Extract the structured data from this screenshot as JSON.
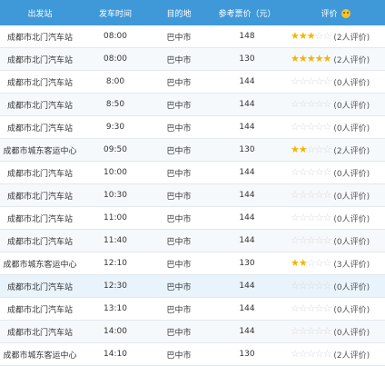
{
  "header": {
    "station": "出发站",
    "time": "发车时间",
    "destination": "目的地",
    "price": "参考票价（元）",
    "rating": "评价",
    "rating_icon": "smiley-face-icon"
  },
  "colors": {
    "header_bg": "#3f99d8",
    "star_on": "#f5b400",
    "star_off": "#d7d7d7"
  },
  "rows": [
    {
      "station": "成都市北门汽车站",
      "time": "08:00",
      "destination": "巴中市",
      "price": "148",
      "stars": 3,
      "count": "(2人评价)"
    },
    {
      "station": "成都市北门汽车站",
      "time": "08:00",
      "destination": "巴中市",
      "price": "130",
      "stars": 5,
      "count": "(2人评价)"
    },
    {
      "station": "成都市北门汽车站",
      "time": "8:00",
      "destination": "巴中市",
      "price": "144",
      "stars": 0,
      "count": "(0人评价)"
    },
    {
      "station": "成都市北门汽车站",
      "time": "8:50",
      "destination": "巴中市",
      "price": "144",
      "stars": 0,
      "count": "(0人评价)"
    },
    {
      "station": "成都市北门汽车站",
      "time": "9:30",
      "destination": "巴中市",
      "price": "144",
      "stars": 0,
      "count": "(0人评价)"
    },
    {
      "station": "成都市城东客运中心",
      "time": "09:50",
      "destination": "巴中市",
      "price": "130",
      "stars": 2,
      "count": "(2人评价)"
    },
    {
      "station": "成都市北门汽车站",
      "time": "10:00",
      "destination": "巴中市",
      "price": "144",
      "stars": 0,
      "count": "(0人评价)"
    },
    {
      "station": "成都市北门汽车站",
      "time": "10:30",
      "destination": "巴中市",
      "price": "144",
      "stars": 0,
      "count": "(0人评价)"
    },
    {
      "station": "成都市北门汽车站",
      "time": "11:00",
      "destination": "巴中市",
      "price": "144",
      "stars": 0,
      "count": "(0人评价)"
    },
    {
      "station": "成都市北门汽车站",
      "time": "11:40",
      "destination": "巴中市",
      "price": "144",
      "stars": 0,
      "count": "(0人评价)"
    },
    {
      "station": "成都市城东客运中心",
      "time": "12:10",
      "destination": "巴中市",
      "price": "130",
      "stars": 2,
      "count": "(3人评价)"
    },
    {
      "station": "成都市北门汽车站",
      "time": "12:30",
      "destination": "巴中市",
      "price": "144",
      "stars": 0,
      "count": "(0人评价)",
      "highlight": true
    },
    {
      "station": "成都市北门汽车站",
      "time": "13:10",
      "destination": "巴中市",
      "price": "144",
      "stars": 0,
      "count": "(0人评价)"
    },
    {
      "station": "成都市北门汽车站",
      "time": "14:00",
      "destination": "巴中市",
      "price": "144",
      "stars": 0,
      "count": "(0人评价)"
    },
    {
      "station": "成都市城东客运中心",
      "time": "14:10",
      "destination": "巴中市",
      "price": "130",
      "stars": 0,
      "count": "(2人评价)"
    }
  ]
}
